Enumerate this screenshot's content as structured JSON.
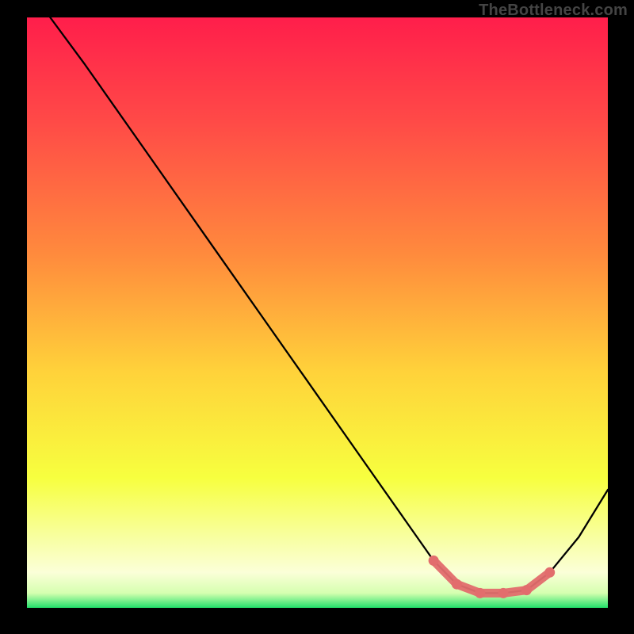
{
  "watermark": "TheBottleneck.com",
  "chart_data": {
    "type": "line",
    "title": "",
    "xlabel": "",
    "ylabel": "",
    "xlim": [
      0,
      100
    ],
    "ylim": [
      0,
      100
    ],
    "series": [
      {
        "name": "bottleneck-curve",
        "x": [
          4,
          10,
          20,
          30,
          40,
          50,
          60,
          65,
          70,
          74,
          78,
          82,
          86,
          90,
          95,
          100
        ],
        "y": [
          100,
          92,
          78,
          64,
          50,
          36,
          22,
          15,
          8,
          4,
          2.5,
          2.5,
          3,
          6,
          12,
          20
        ]
      },
      {
        "name": "optimal-range-highlight",
        "x": [
          70,
          74,
          78,
          82,
          86,
          90
        ],
        "y": [
          8,
          4,
          2.5,
          2.5,
          3,
          6
        ]
      }
    ],
    "gradient_stops": [
      {
        "offset": 0.0,
        "color": "#ff1e4b"
      },
      {
        "offset": 0.18,
        "color": "#ff4b47"
      },
      {
        "offset": 0.4,
        "color": "#ff8a3d"
      },
      {
        "offset": 0.6,
        "color": "#ffd23a"
      },
      {
        "offset": 0.78,
        "color": "#f7ff3f"
      },
      {
        "offset": 0.88,
        "color": "#f8ffa0"
      },
      {
        "offset": 0.94,
        "color": "#fbffd8"
      },
      {
        "offset": 0.975,
        "color": "#d6ffb0"
      },
      {
        "offset": 1.0,
        "color": "#22e06a"
      }
    ]
  }
}
